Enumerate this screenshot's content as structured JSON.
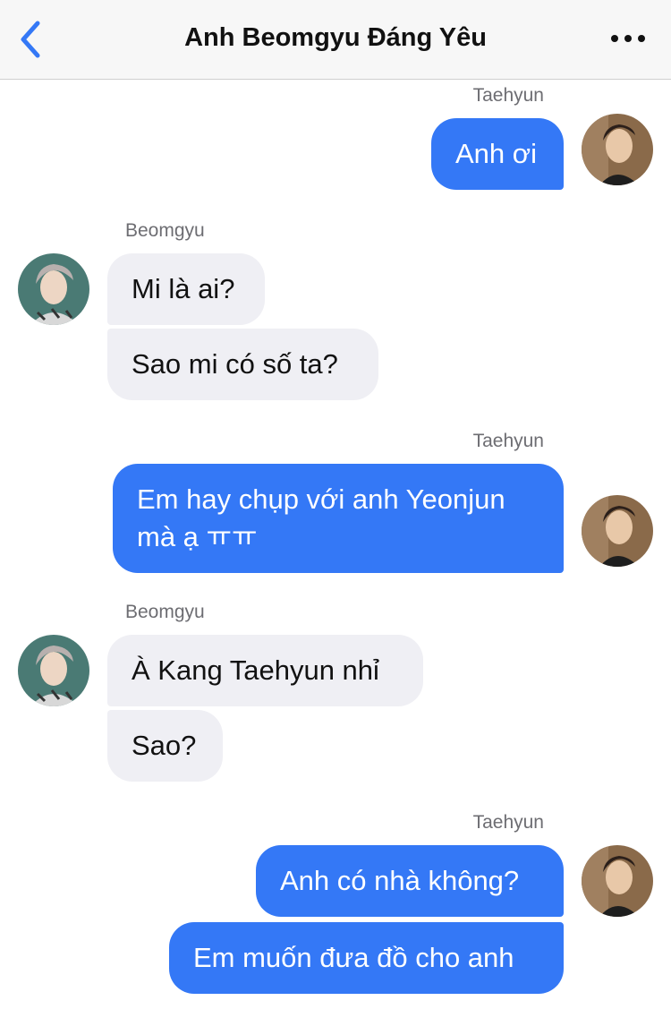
{
  "header": {
    "title": "Anh Beomgyu Đáng Yêu",
    "back_icon": "chevron-left-icon",
    "more_icon": "ellipsis-icon"
  },
  "colors": {
    "outgoing": "#3478f6",
    "incoming": "#efeff4",
    "accent": "#3478f6"
  },
  "messages": [
    {
      "sender": "Taehyun",
      "text": "Anh ơi"
    },
    {
      "sender": "Beomgyu",
      "text": "Mi là ai?"
    },
    {
      "text": "Sao mi có số ta?"
    },
    {
      "sender": "Taehyun",
      "text": "Em hay chụp với anh Yeonjun mà ạ ㅠㅠ"
    },
    {
      "sender": "Beomgyu",
      "text": "À Kang Taehyun nhỉ"
    },
    {
      "text": "Sao?"
    },
    {
      "sender": "Taehyun",
      "text": "Anh có nhà không?"
    },
    {
      "text": "Em muốn đưa đồ cho anh"
    }
  ]
}
